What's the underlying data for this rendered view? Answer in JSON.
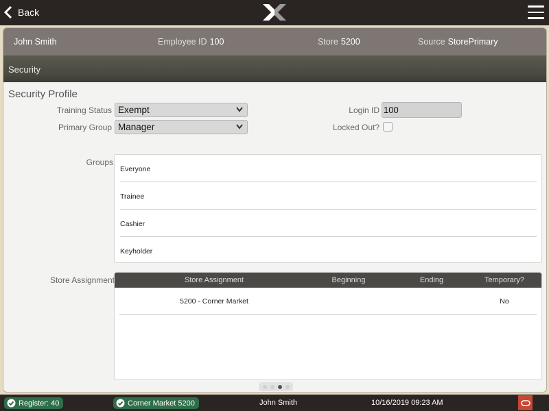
{
  "topbar": {
    "back_label": "Back",
    "logo_icon": "x-logo-icon",
    "menu_icon": "hamburger-menu-icon"
  },
  "employee": {
    "name": "John Smith",
    "employee_id_label": "Employee ID",
    "employee_id": "100",
    "store_label": "Store",
    "store": "5200",
    "source_label": "Source",
    "source": "StorePrimary"
  },
  "section_title": "Security",
  "profile": {
    "title": "Security Profile",
    "training_status_label": "Training Status",
    "training_status": "Exempt",
    "primary_group_label": "Primary Group",
    "primary_group": "Manager",
    "login_id_label": "Login ID",
    "login_id": "100",
    "locked_out_label": "Locked Out?",
    "locked_out": false
  },
  "groups": {
    "label": "Groups",
    "items": [
      "Everyone",
      "Trainee",
      "Cashier",
      "Keyholder"
    ]
  },
  "store_assignment": {
    "label": "Store Assignment",
    "columns": [
      "Store Assignment",
      "Beginning",
      "Ending",
      "Temporary?"
    ],
    "rows": [
      {
        "store": "5200 - Corner Market",
        "beginning": "",
        "ending": "",
        "temporary": "No"
      }
    ]
  },
  "pager": {
    "total": 4,
    "active": 3
  },
  "statusbar": {
    "register": "Register: 40",
    "store": "Corner Market 5200",
    "user": "John Smith",
    "datetime": "10/16/2019 09:23 AM"
  },
  "colors": {
    "badge_green": "#2e6e48",
    "oracle_red": "#c74634",
    "bar_dark": "#2a2522"
  }
}
